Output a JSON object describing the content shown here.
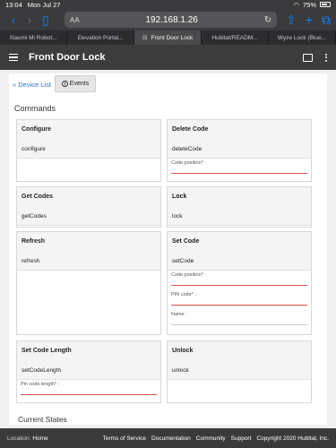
{
  "status_bar": {
    "time": "13:04",
    "date": "Mon Jul 27",
    "battery": "75%"
  },
  "browser": {
    "aa": "AA",
    "url": "192.168.1.26",
    "tabs": [
      {
        "label": "Xiaomi Mi Robot...",
        "active": false
      },
      {
        "label": "Elevation Portal...",
        "active": false
      },
      {
        "label": "Front Door Lock",
        "active": true
      },
      {
        "label": "Hubitat/READM...",
        "active": false
      },
      {
        "label": "Wyze Lock (Blue...",
        "active": false
      }
    ]
  },
  "header": {
    "title": "Front Door Lock"
  },
  "toolbar": {
    "device_list": "« Device List",
    "events": "Events"
  },
  "commands_title": "Commands",
  "commands": [
    {
      "name": "Configure",
      "method": "configure"
    },
    {
      "name": "Delete Code",
      "method": "deleteCode",
      "fields": [
        "Code position* :"
      ]
    },
    {
      "name": "Get Codes",
      "method": "getCodes"
    },
    {
      "name": "Lock",
      "method": "lock"
    },
    {
      "name": "Refresh",
      "method": "refresh"
    },
    {
      "name": "Set Code",
      "method": "setCode",
      "fields": [
        "Code position* :",
        "PIN code* :",
        "Name :"
      ]
    },
    {
      "name": "Set Code Length",
      "method": "setCodeLength",
      "fields": [
        "Pin code length* :"
      ]
    },
    {
      "name": "Unlock",
      "method": "unlock"
    }
  ],
  "states_title": "Current States",
  "footer": {
    "location_label": "Location:",
    "location_value": "Home",
    "links": [
      "Terms of Service",
      "Documentation",
      "Community",
      "Support"
    ],
    "copyright": "Copyright 2020 Hubitat, Inc."
  }
}
